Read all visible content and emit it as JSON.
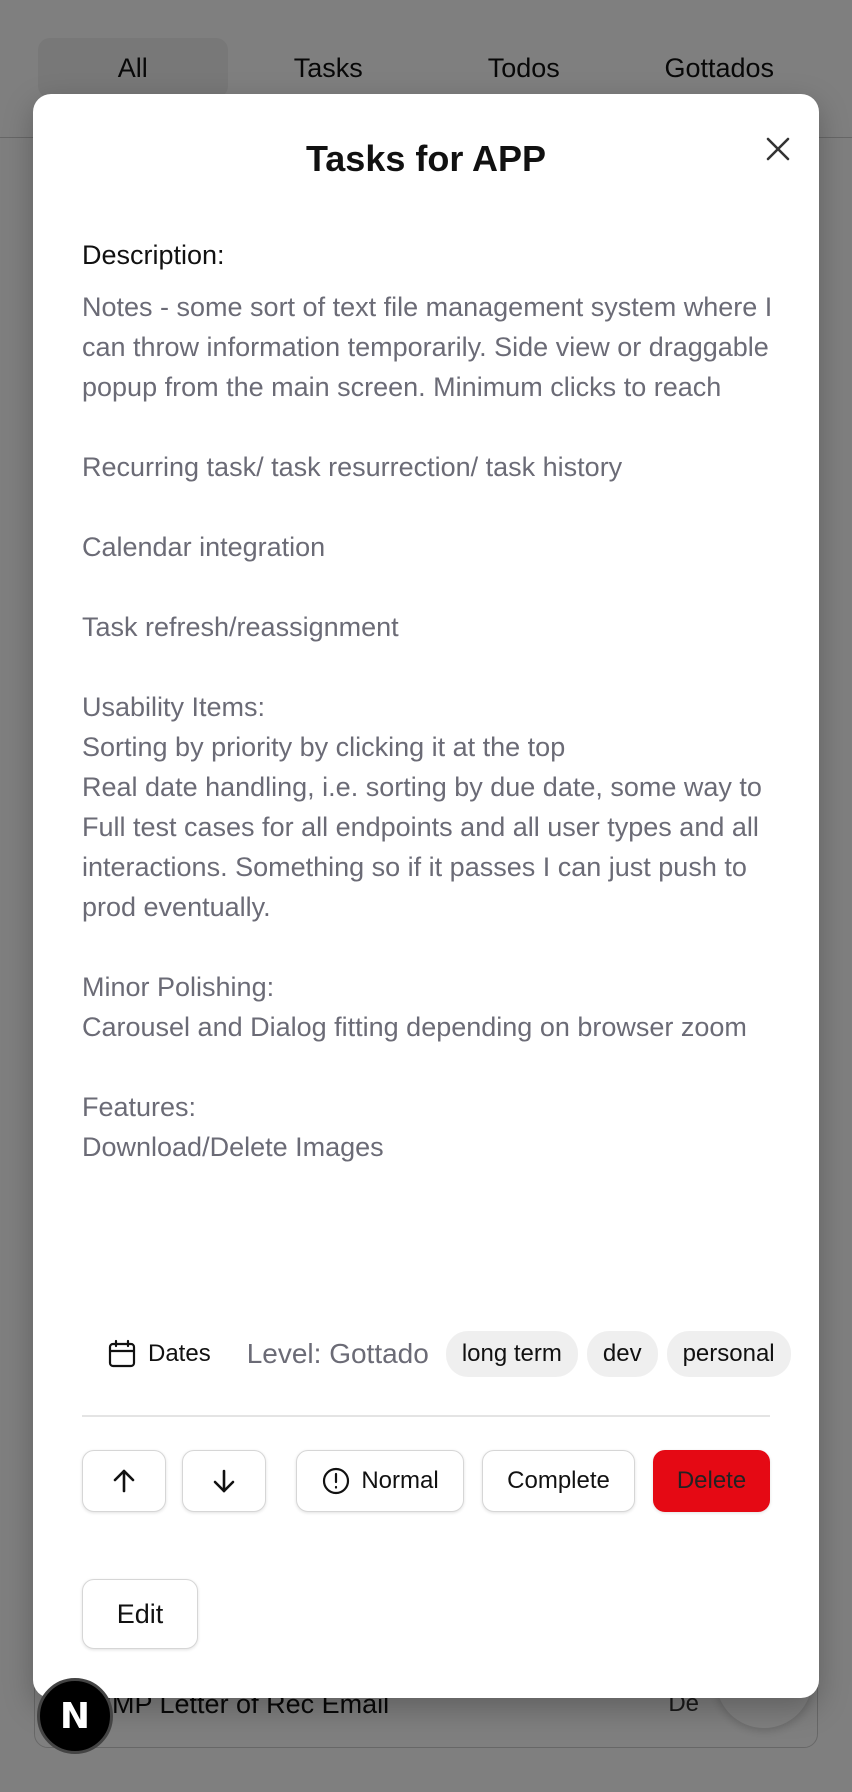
{
  "tabs": [
    "All",
    "Tasks",
    "Todos",
    "Gottados"
  ],
  "background_card": {
    "title": "NIMP Letter of Rec Email",
    "date": "De"
  },
  "next_badge": "N",
  "dialog": {
    "title": "Tasks for APP",
    "description_label": "Description:",
    "description": "Notes - some sort of text file management system where I can throw information temporarily. Side view or draggable popup from the main screen. Minimum clicks to reach\n\nRecurring task/ task resurrection/ task history\n\nCalendar integration\n\nTask refresh/reassignment\n\nUsability Items:\nSorting by priority by clicking it at the top\nReal date handling, i.e. sorting by due date, some way to\nFull test cases for all endpoints and all user types and all interactions. Something so if it passes I can just push to prod eventually.\n\nMinor Polishing:\nCarousel and Dialog fitting depending on browser zoom\n\nFeatures:\nDownload/Delete Images",
    "dates_label": "Dates",
    "level": "Level: Gottado",
    "tags": [
      "long term",
      "dev",
      "personal"
    ],
    "buttons": {
      "priority": "Normal",
      "complete": "Complete",
      "delete": "Delete",
      "edit": "Edit"
    }
  },
  "colors": {
    "delete_bg": "#e50914",
    "overlay": "rgba(0,0,0,0.5)",
    "muted_text": "#6b6b76"
  }
}
